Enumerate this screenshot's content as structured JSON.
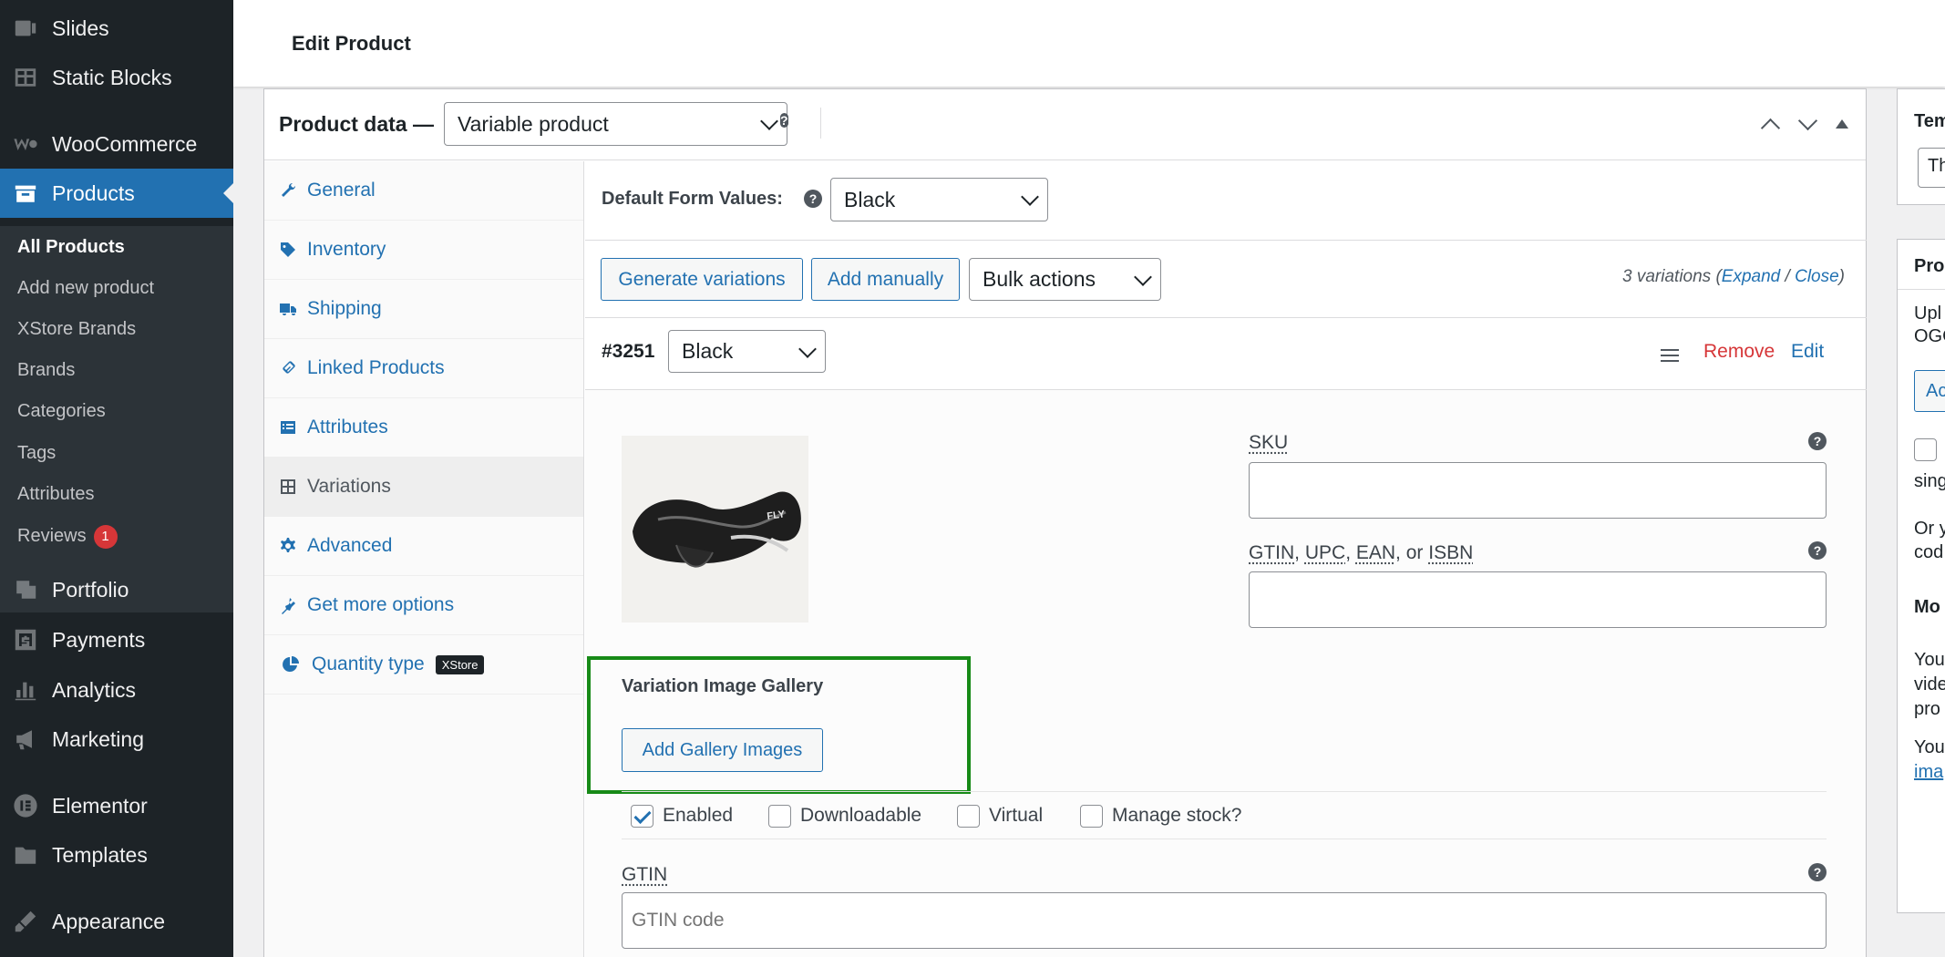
{
  "sidebar": {
    "items": [
      {
        "label": "Slides",
        "icon": "slides-icon"
      },
      {
        "label": "Static Blocks",
        "icon": "static-blocks-icon"
      },
      {
        "label": "WooCommerce",
        "icon": "woocommerce-icon"
      },
      {
        "label": "Products",
        "icon": "products-icon",
        "active": true
      },
      {
        "label": "Portfolio",
        "icon": "portfolio-icon"
      },
      {
        "label": "Payments",
        "icon": "payments-icon"
      },
      {
        "label": "Analytics",
        "icon": "analytics-icon"
      },
      {
        "label": "Marketing",
        "icon": "marketing-icon"
      },
      {
        "label": "Elementor",
        "icon": "elementor-icon"
      },
      {
        "label": "Templates",
        "icon": "templates-icon"
      },
      {
        "label": "Appearance",
        "icon": "appearance-icon"
      }
    ],
    "submenu": [
      {
        "label": "All Products",
        "current": true
      },
      {
        "label": "Add new product"
      },
      {
        "label": "XStore Brands"
      },
      {
        "label": "Brands"
      },
      {
        "label": "Categories"
      },
      {
        "label": "Tags"
      },
      {
        "label": "Attributes"
      },
      {
        "label": "Reviews",
        "badge": "1"
      }
    ]
  },
  "header": {
    "title": "Edit Product"
  },
  "product_data": {
    "label": "Product data —",
    "type_value": "Variable product",
    "help": "?"
  },
  "tabs": [
    {
      "label": "General",
      "icon": "wrench-icon"
    },
    {
      "label": "Inventory",
      "icon": "tag-icon"
    },
    {
      "label": "Shipping",
      "icon": "truck-icon"
    },
    {
      "label": "Linked Products",
      "icon": "link-icon"
    },
    {
      "label": "Attributes",
      "icon": "list-icon"
    },
    {
      "label": "Variations",
      "icon": "grid-icon",
      "current": true
    },
    {
      "label": "Advanced",
      "icon": "gear-icon"
    },
    {
      "label": "Get more options",
      "icon": "plugin-icon"
    },
    {
      "label": "Quantity type",
      "icon": "pie-icon",
      "tag": "XStore"
    }
  ],
  "variations": {
    "default_label": "Default Form Values:",
    "default_value": "Black",
    "generate_label": "Generate variations",
    "add_manually_label": "Add manually",
    "bulk_actions_value": "Bulk actions",
    "count_text": "3 variations",
    "expand_label": "Expand",
    "close_label": "Close",
    "variation": {
      "id": "#3251",
      "color_value": "Black",
      "remove_label": "Remove",
      "edit_label": "Edit",
      "sku_label": "SKU",
      "gtin_label_parts": [
        "GTIN",
        "UPC",
        "EAN",
        "ISBN"
      ],
      "gtin_label_sep1": ", ",
      "gtin_label_sep_or": ", or ",
      "gallery_title": "Variation Image Gallery",
      "gallery_button": "Add Gallery Images",
      "checks": [
        {
          "label": "Enabled",
          "checked": true
        },
        {
          "label": "Downloadable",
          "checked": false
        },
        {
          "label": "Virtual",
          "checked": false
        },
        {
          "label": "Manage stock?",
          "checked": false
        }
      ],
      "gtin_code_label": "GTIN",
      "gtin_code_placeholder": "GTIN code"
    }
  },
  "right_column": {
    "template_label": "Tem",
    "template_value": "Th",
    "box_title": "Pro",
    "lines": [
      "Upl",
      "OGG",
      "Ac",
      "sing",
      "Or y",
      "cod",
      "Mo",
      "You",
      "vide",
      "pro",
      "You",
      "ima"
    ]
  },
  "colors": {
    "accent": "#2271b1",
    "sidebar": "#1d2327",
    "highlight_box": "#178a17",
    "danger": "#d63638"
  }
}
